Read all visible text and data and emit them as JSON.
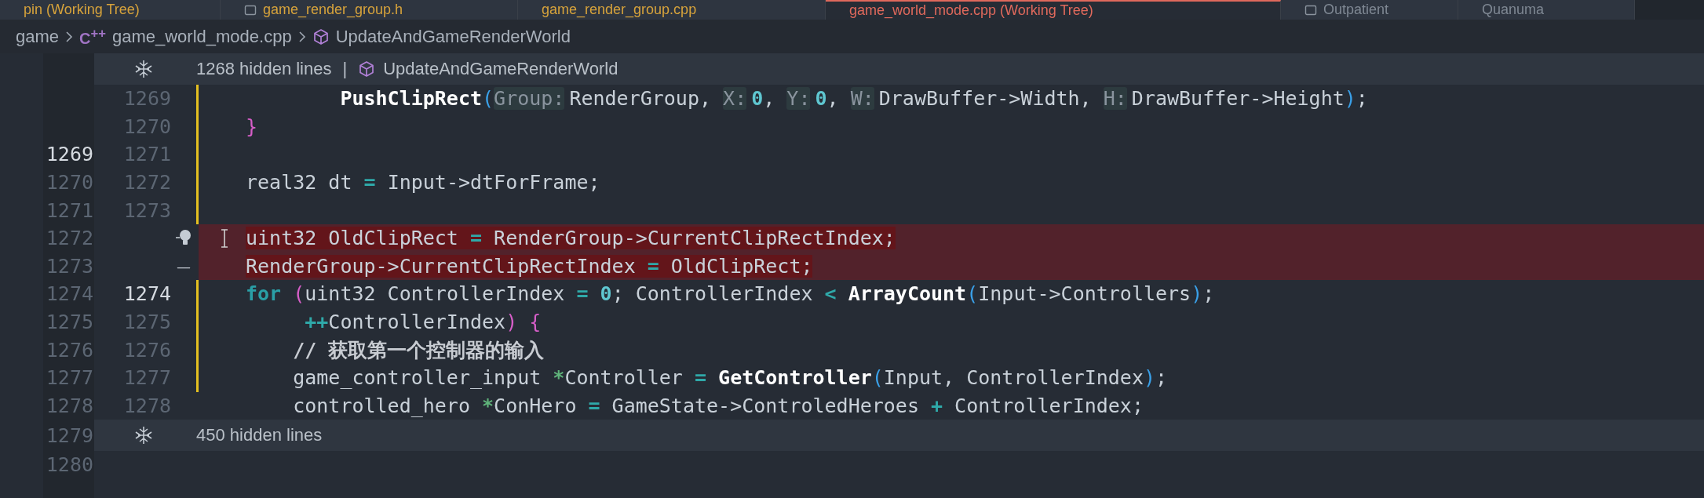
{
  "tabs": [
    {
      "label": "pin (Working Tree)",
      "selected": false,
      "icon": false,
      "color": "#d7a33b"
    },
    {
      "label": "game_render_group.h",
      "selected": false,
      "icon": true,
      "color": "#d7a33b"
    },
    {
      "label": "game_render_group.cpp",
      "selected": false,
      "icon": false,
      "color": "#d7a33b"
    },
    {
      "label": "game_world_mode.cpp (Working Tree)",
      "selected": true,
      "icon": false,
      "color": "#e0695c"
    },
    {
      "label": "Outpatient",
      "selected": false,
      "icon": true,
      "color": "#7f8893"
    },
    {
      "label": "Quanuma",
      "selected": false,
      "icon": false,
      "color": "#7f8893"
    }
  ],
  "breadcrumb": [
    {
      "kind": "folder",
      "label": "game"
    },
    {
      "kind": "file",
      "badge": "C$^{++}$",
      "label": "game_world_mode.cpp"
    },
    {
      "kind": "symbol",
      "label": "UpdateAndGameRenderWorld"
    }
  ],
  "rows": [
    {
      "kind": "fold",
      "label": "1268 hidden lines",
      "separator": "|",
      "symbol": "UpdateAndGameRenderWorld"
    },
    {
      "kind": "changed",
      "new": "1269",
      "current_new": false,
      "tokens": [
        {
          "t": "        PushClipRect",
          "kind": "fn"
        },
        {
          "t": "(",
          "kind": "paren"
        },
        {
          "t": "Group:",
          "kind": "hint"
        },
        {
          "t": "RenderGroup, ",
          "kind": "plain"
        },
        {
          "t": "X:",
          "kind": "hint"
        },
        {
          "t": "0",
          "kind": "num"
        },
        {
          "t": ", ",
          "kind": "plain"
        },
        {
          "t": "Y:",
          "kind": "hint"
        },
        {
          "t": "0",
          "kind": "num"
        },
        {
          "t": ", ",
          "kind": "plain"
        },
        {
          "t": "W:",
          "kind": "hint"
        },
        {
          "t": "DrawBuffer->Width, ",
          "kind": "plain"
        },
        {
          "t": "H:",
          "kind": "hint"
        },
        {
          "t": "DrawBuffer->Height",
          "kind": "plain"
        },
        {
          "t": ")",
          "kind": "paren"
        },
        {
          "t": ";",
          "kind": "plain"
        }
      ]
    },
    {
      "kind": "changed",
      "new": "1270",
      "current_new": false,
      "tokens": [
        {
          "t": "}",
          "kind": "brace"
        }
      ]
    },
    {
      "kind": "changed",
      "old": "1269",
      "new": "1271",
      "current_old": true,
      "current_new": false
    },
    {
      "kind": "changed",
      "old": "1270",
      "new": "1272",
      "current_old": false,
      "current_new": false,
      "tokens": [
        {
          "t": "real32 dt",
          "kind": "plain"
        },
        {
          "t": " =",
          "kind": "op"
        },
        {
          "t": " Input->dtForFrame;",
          "kind": "plain"
        }
      ]
    },
    {
      "kind": "changed",
      "old": "1271",
      "new": "1273",
      "current_old": false,
      "current_new": false
    },
    {
      "kind": "deleted",
      "old": "1272",
      "current_old": false,
      "lightbulb": true,
      "tokens": [
        {
          "t": "uint32 OldClipRect",
          "kind": "plain"
        },
        {
          "t": " =",
          "kind": "op"
        },
        {
          "t": " RenderGroup->CurrentClipRectIndex;",
          "kind": "plain"
        }
      ]
    },
    {
      "kind": "deleted",
      "old": "1273",
      "current_old": false,
      "sign": "—",
      "tokens": [
        {
          "t": "RenderGroup->CurrentClipRectIndex",
          "kind": "plain"
        },
        {
          "t": " =",
          "kind": "op"
        },
        {
          "t": " OldClipRect;",
          "kind": "plain"
        }
      ]
    },
    {
      "kind": "changed",
      "old": "1274",
      "new": "1274",
      "current_old": false,
      "current_new": true,
      "tokens": [
        {
          "t": "for",
          "kind": "kw"
        },
        {
          "t": " (",
          "kind": "brace"
        },
        {
          "t": "uint32 ControllerIndex",
          "kind": "plain"
        },
        {
          "t": " =",
          "kind": "op"
        },
        {
          "t": " 0",
          "kind": "num"
        },
        {
          "t": "; ControllerIndex",
          "kind": "plain"
        },
        {
          "t": " <",
          "kind": "op"
        },
        {
          "t": " ArrayCount",
          "kind": "fn"
        },
        {
          "t": "(",
          "kind": "paren"
        },
        {
          "t": "Input->Controllers",
          "kind": "plain"
        },
        {
          "t": ")",
          "kind": "paren"
        },
        {
          "t": ";",
          "kind": "plain"
        }
      ]
    },
    {
      "kind": "changed",
      "old": "1275",
      "new": "1275",
      "current_old": false,
      "current_new": false,
      "tokens": [
        {
          "t": "     ++",
          "kind": "op"
        },
        {
          "t": "ControllerIndex",
          "kind": "plain"
        },
        {
          "t": ")",
          "kind": "brace"
        },
        {
          "t": " {",
          "kind": "brace"
        }
      ]
    },
    {
      "kind": "changed",
      "old": "1276",
      "new": "1276",
      "current_old": false,
      "current_new": false,
      "tokens": [
        {
          "t": "    // 获取第一个控制器的输入",
          "kind": "comment"
        }
      ]
    },
    {
      "kind": "changed",
      "old": "1277",
      "new": "1277",
      "current_old": false,
      "current_new": false,
      "tokens": [
        {
          "t": "    game_controller_input ",
          "kind": "plain"
        },
        {
          "t": "*",
          "kind": "star"
        },
        {
          "t": "Controller",
          "kind": "plain"
        },
        {
          "t": " =",
          "kind": "op"
        },
        {
          "t": " GetController",
          "kind": "fn"
        },
        {
          "t": "(",
          "kind": "paren"
        },
        {
          "t": "Input, ControllerIndex",
          "kind": "plain"
        },
        {
          "t": ")",
          "kind": "paren"
        },
        {
          "t": ";",
          "kind": "plain"
        }
      ]
    },
    {
      "kind": "context",
      "old": "1278",
      "new": "1278",
      "current_old": false,
      "current_new": false,
      "tokens": [
        {
          "t": "    controlled_hero ",
          "kind": "plain"
        },
        {
          "t": "*",
          "kind": "star"
        },
        {
          "t": "ConHero",
          "kind": "plain"
        },
        {
          "t": " =",
          "kind": "op"
        },
        {
          "t": " GameState->ControledHeroes",
          "kind": "plain"
        },
        {
          "t": " +",
          "kind": "op"
        },
        {
          "t": " ControllerIndex;",
          "kind": "plain"
        }
      ]
    },
    {
      "kind": "fold",
      "old": "1279",
      "label": "450 hidden lines"
    },
    {
      "kind": "context",
      "old": "1280",
      "current_old": false
    }
  ]
}
